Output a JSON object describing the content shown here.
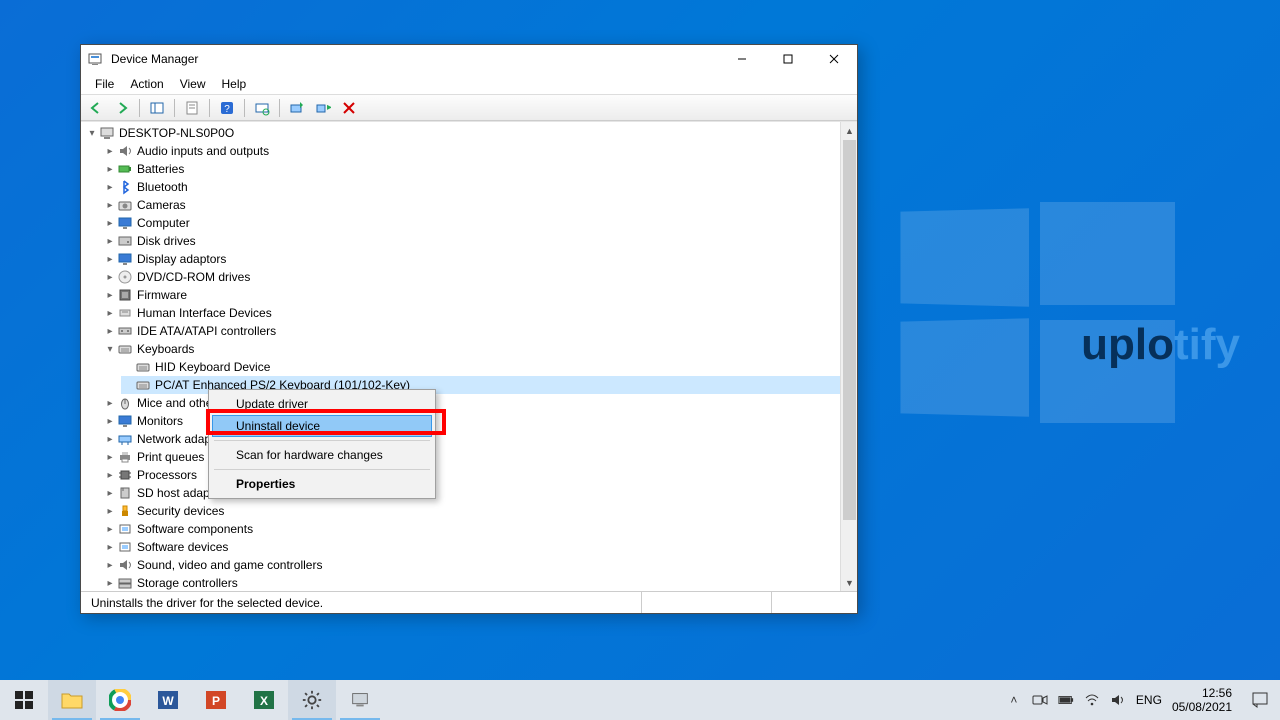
{
  "window": {
    "title": "Device Manager",
    "menus": [
      "File",
      "Action",
      "View",
      "Help"
    ],
    "status": "Uninstalls the driver for the selected device."
  },
  "tree": {
    "root": "DESKTOP-NLS0P0O",
    "categories": [
      {
        "label": "Audio inputs and outputs",
        "expanded": false
      },
      {
        "label": "Batteries",
        "expanded": false
      },
      {
        "label": "Bluetooth",
        "expanded": false
      },
      {
        "label": "Cameras",
        "expanded": false
      },
      {
        "label": "Computer",
        "expanded": false
      },
      {
        "label": "Disk drives",
        "expanded": false
      },
      {
        "label": "Display adaptors",
        "expanded": false
      },
      {
        "label": "DVD/CD-ROM drives",
        "expanded": false
      },
      {
        "label": "Firmware",
        "expanded": false
      },
      {
        "label": "Human Interface Devices",
        "expanded": false
      },
      {
        "label": "IDE ATA/ATAPI controllers",
        "expanded": false
      },
      {
        "label": "Keyboards",
        "expanded": true,
        "children": [
          {
            "label": "HID Keyboard Device"
          },
          {
            "label": "PC/AT Enhanced PS/2 Keyboard (101/102-Key)",
            "selected": true
          }
        ]
      },
      {
        "label": "Mice and other pointing devices",
        "expanded": false
      },
      {
        "label": "Monitors",
        "expanded": false
      },
      {
        "label": "Network adapters",
        "expanded": false
      },
      {
        "label": "Print queues",
        "expanded": false
      },
      {
        "label": "Processors",
        "expanded": false
      },
      {
        "label": "SD host adapters",
        "expanded": false
      },
      {
        "label": "Security devices",
        "expanded": false
      },
      {
        "label": "Software components",
        "expanded": false
      },
      {
        "label": "Software devices",
        "expanded": false
      },
      {
        "label": "Sound, video and game controllers",
        "expanded": false
      },
      {
        "label": "Storage controllers",
        "expanded": false
      }
    ]
  },
  "context_menu": {
    "items": [
      {
        "label": "Update driver"
      },
      {
        "label": "Uninstall device",
        "hover": true
      },
      {
        "separator": true
      },
      {
        "label": "Scan for hardware changes"
      },
      {
        "separator": true
      },
      {
        "label": "Properties",
        "bold": true
      }
    ]
  },
  "taskbar": {
    "tray": {
      "lang": "ENG",
      "time": "12:56",
      "date": "05/08/2021"
    }
  },
  "watermark": {
    "part1": "uplo",
    "part2": "tify"
  }
}
